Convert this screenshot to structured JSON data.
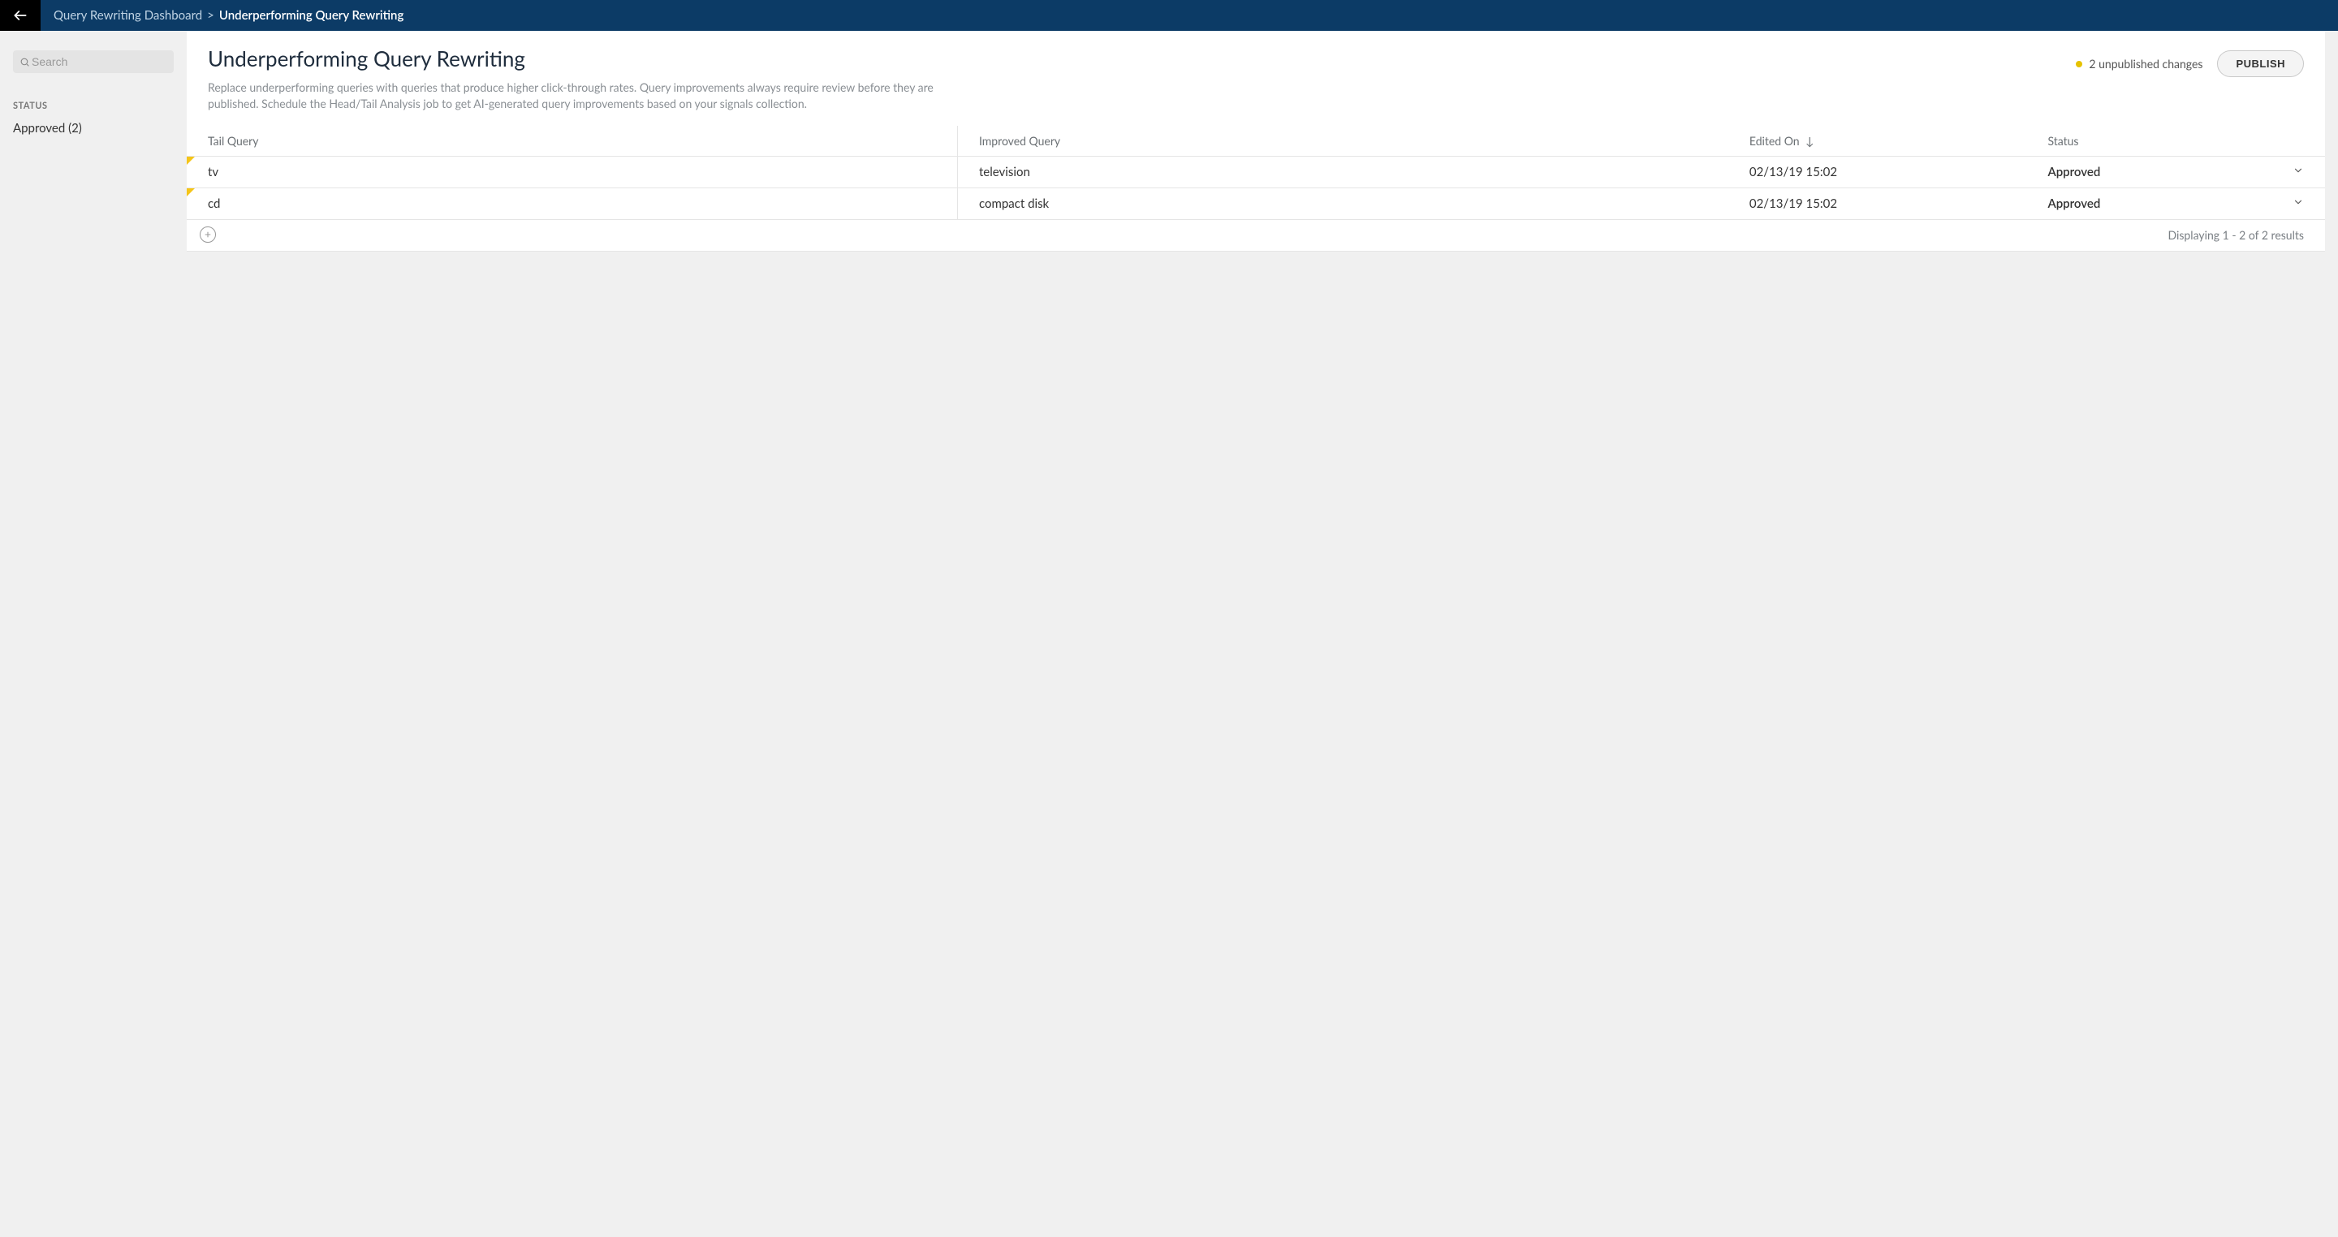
{
  "topbar": {
    "breadcrumb_parent": "Query Rewriting Dashboard",
    "breadcrumb_sep": ">",
    "breadcrumb_current": "Underperforming Query Rewriting"
  },
  "sidebar": {
    "search_placeholder": "Search",
    "filter_heading": "STATUS",
    "filter_item": "Approved (2)"
  },
  "page": {
    "title": "Underperforming Query Rewriting",
    "description": "Replace underperforming queries with queries that produce higher click-through rates. Query improvements always require review before they are published. Schedule the Head/Tail Analysis job to get AI-generated query improvements based on your signals collection.",
    "changes_text": "2 unpublished changes",
    "publish_label": "PUBLISH"
  },
  "table": {
    "headers": {
      "tail": "Tail Query",
      "improved": "Improved Query",
      "edited": "Edited On",
      "status": "Status"
    },
    "rows": [
      {
        "tail": "tv",
        "improved": "television",
        "edited": "02/13/19 15:02",
        "status": "Approved"
      },
      {
        "tail": "cd",
        "improved": "compact disk",
        "edited": "02/13/19 15:02",
        "status": "Approved"
      }
    ],
    "results_text": "Displaying 1 - 2 of 2 results"
  }
}
